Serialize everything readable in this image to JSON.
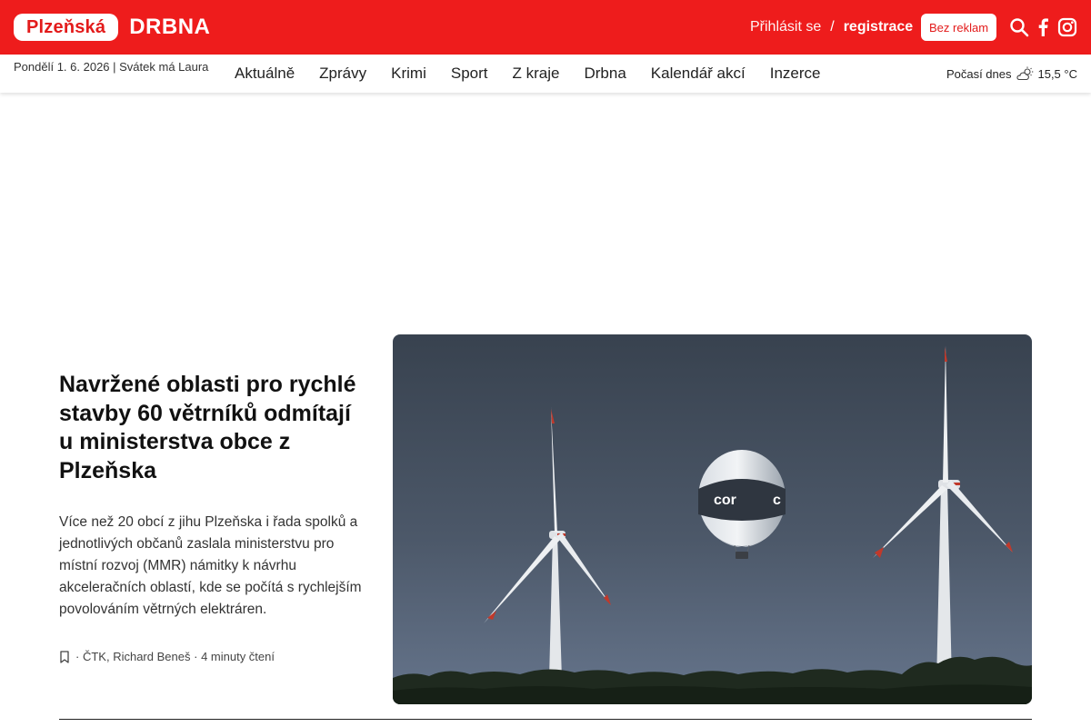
{
  "header": {
    "logo_pill": "Plzeňská",
    "logo_word": "DRBNA",
    "login": "Přihlásit se",
    "separator": "/",
    "register": "registrace",
    "no_ads": "Bez reklam",
    "icons": [
      "search-icon",
      "facebook-icon",
      "instagram-icon"
    ]
  },
  "subheader": {
    "date_line": "Pondělí 1. 6. 2026  |  Svátek má Laura",
    "nav": [
      "Aktuálně",
      "Zprávy",
      "Krimi",
      "Sport",
      "Z kraje",
      "Drbna",
      "Kalendář akcí",
      "Inzerce"
    ],
    "weather_label": "Počasí dnes",
    "weather_icon": "partly-cloudy-icon",
    "temperature": "15,5 °C"
  },
  "article": {
    "title": "Navržené oblasti pro rychlé stavby 60 větrníků odmítají u ministerstva obce z Plzeňska",
    "perex": "Více než 20 obcí z jihu Plzeňska i řada spolků a jednotlivých občanů zaslala ministerstvu pro místní rozvoj (MMR) námitky k návrhu akceleračních oblastí, kde se počítá s rychlejším povolováním větrných elektráren.",
    "meta_sep": "·",
    "authors": "ČTK, Richard Beneš",
    "read_time": "4 minuty čtení",
    "image_subject": "wind-turbines-with-hot-air-balloon"
  },
  "colors": {
    "brand_red": "#ee1c1c",
    "sky_top": "#3b4656",
    "sky_bottom": "#5f6e84"
  }
}
